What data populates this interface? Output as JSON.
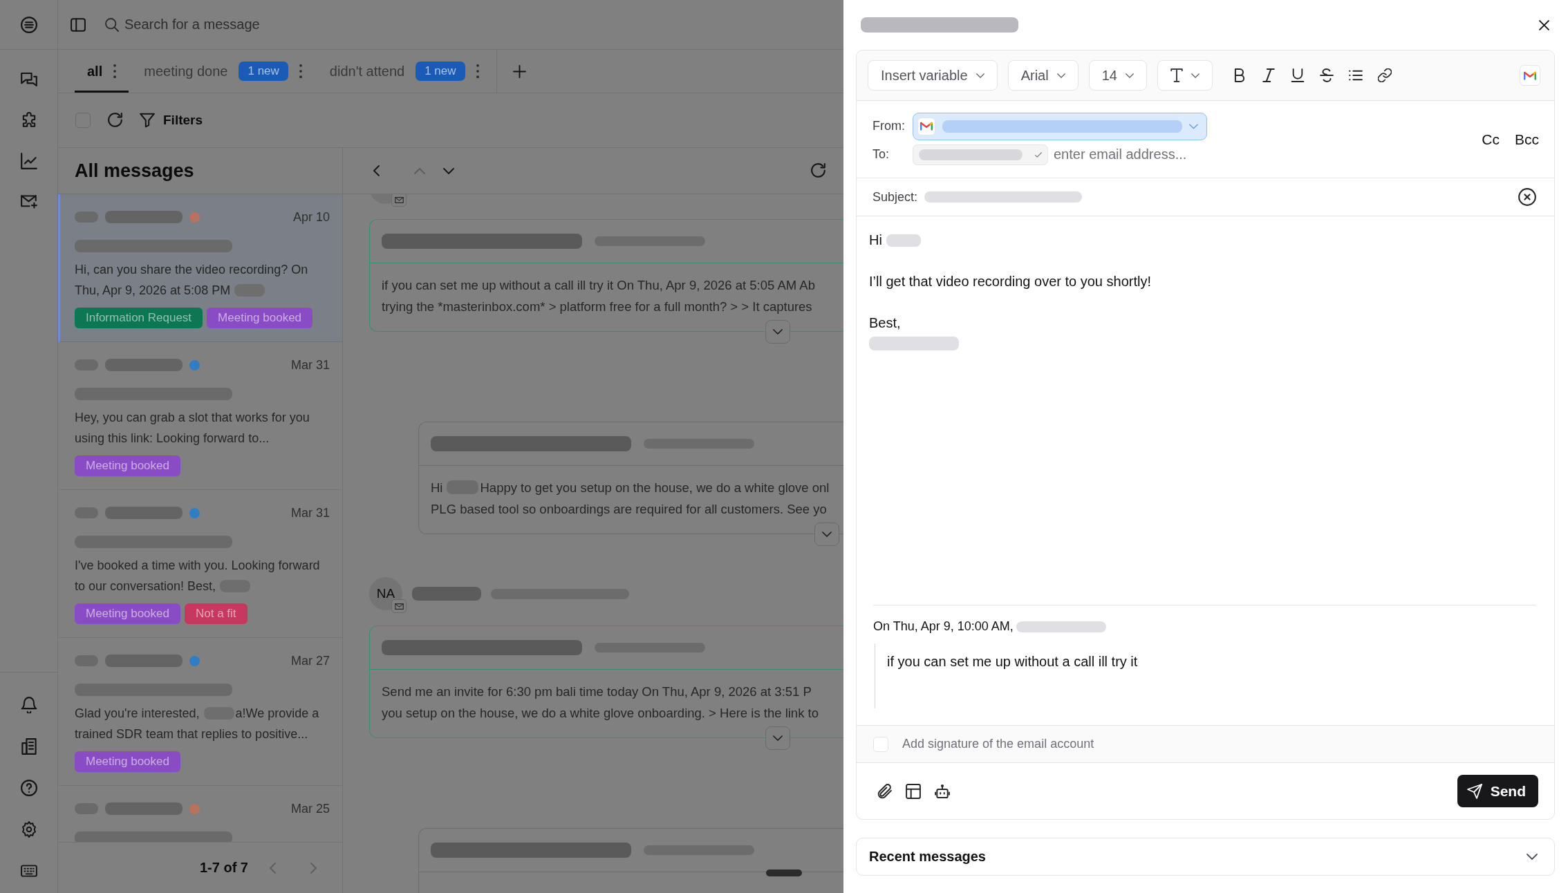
{
  "search": {
    "placeholder": "Search for a message"
  },
  "tabs": [
    {
      "label": "all",
      "selected": true
    },
    {
      "label": "meeting done",
      "badge": "1 new",
      "selected": false
    },
    {
      "label": "didn't attend",
      "badge": "1 new",
      "selected": false
    }
  ],
  "filter_bar": {
    "select_all": {
      "checked": false
    },
    "filters": "Filters"
  },
  "list": {
    "title": "All messages",
    "messages": [
      {
        "selected": true,
        "color": "#b8725f",
        "date": "Apr 10",
        "preview": [
          {
            "kind": "text",
            "text": "Hi, can you share the video recording? On Thu, Apr 9, 2026 at 5:08 PM"
          },
          {
            "kind": "redacted"
          }
        ],
        "tags": [
          {
            "label": "Information Request",
            "color": "#0d7653"
          },
          {
            "label": "Meeting booked",
            "color": "#8a4cc4"
          }
        ]
      },
      {
        "selected": false,
        "color": "#2f7dc2",
        "date": "Mar 31",
        "preview": [
          {
            "kind": "text",
            "text": "Hey, you can grab a slot that works for you using this link: Looking forward to..."
          }
        ],
        "tags": [
          {
            "label": "Meeting booked",
            "color": "#8a4cc4"
          }
        ]
      },
      {
        "selected": false,
        "color": "#2f7dc2",
        "date": "Mar 31",
        "preview": [
          {
            "kind": "text",
            "text": "I've booked a time with you. Looking forward to our conversation! Best,"
          },
          {
            "kind": "redacted"
          }
        ],
        "tags": [
          {
            "label": "Meeting booked",
            "color": "#8a4cc4"
          },
          {
            "label": "Not a fit",
            "color": "#c6385f"
          }
        ]
      },
      {
        "selected": false,
        "color": "#2f7dc2",
        "date": "Mar 27",
        "preview": [
          {
            "kind": "text",
            "text": "Glad you're interested,"
          },
          {
            "kind": "redacted"
          },
          {
            "kind": "text",
            "text": "a!We provide a trained SDR team that replies to positive..."
          }
        ],
        "tags": [
          {
            "label": "Meeting booked",
            "color": "#8a4cc4"
          }
        ]
      },
      {
        "selected": false,
        "color": "#b8725f",
        "date": "Mar 25"
      }
    ],
    "pagination": {
      "label": "1-7 of 7",
      "prev_disabled": true,
      "next_disabled": true
    }
  },
  "thread": {
    "nav": {
      "up_disabled": true,
      "down_disabled": false
    },
    "items": [
      {
        "kind": "sender"
      },
      {
        "kind": "received",
        "lines": [
          "if you can set me up without a call ill try it On Thu, Apr 9, 2026 at 5:05 AM Ab",
          "trying the *masterinbox.com* > platform free for a full month? > > It captures"
        ]
      },
      {
        "kind": "sent",
        "lines": [
          [
            {
              "kind": "text",
              "text": "Hi"
            },
            {
              "kind": "redacted"
            },
            {
              "kind": "text",
              "text": "Happy to get you setup on the house, we do a white glove onl"
            }
          ],
          "PLG based tool so onboardings are required for all customers. See yo"
        ]
      },
      {
        "kind": "sender",
        "initials": "NA"
      },
      {
        "kind": "received",
        "lines": [
          "Send me an invite for 6:30 pm bali time today On Thu, Apr 9, 2026 at 3:51 P",
          "you setup on the house, we do a white glove onboarding. > Here is the link to"
        ]
      },
      {
        "kind": "sent"
      }
    ]
  },
  "reply": {
    "toolbar": {
      "variable": "Insert variable",
      "font": "Arial",
      "size": "14"
    },
    "from": {
      "label": "From:"
    },
    "to": {
      "label": "To:",
      "placeholder": "enter email address..."
    },
    "cc": "Cc",
    "bcc": "Bcc",
    "subject": {
      "label": "Subject:"
    },
    "body": [
      [
        [
          {
            "kind": "text",
            "text": "Hi"
          },
          {
            "kind": "redacted"
          }
        ]
      ],
      [
        "I’ll get that video recording over to you shortly!"
      ],
      [
        "Best,",
        [
          {
            "kind": "redacted"
          }
        ]
      ]
    ],
    "quote": {
      "header": [
        {
          "kind": "text",
          "text": "On Thu, Apr 9, 10:00 AM,"
        },
        {
          "kind": "redacted"
        }
      ],
      "text": "if you can set me up without a call ill try it"
    },
    "signature": {
      "label": "Add signature of the email account",
      "checked": false
    },
    "send": "Send"
  },
  "recent": {
    "title": "Recent messages",
    "expanded": false
  }
}
